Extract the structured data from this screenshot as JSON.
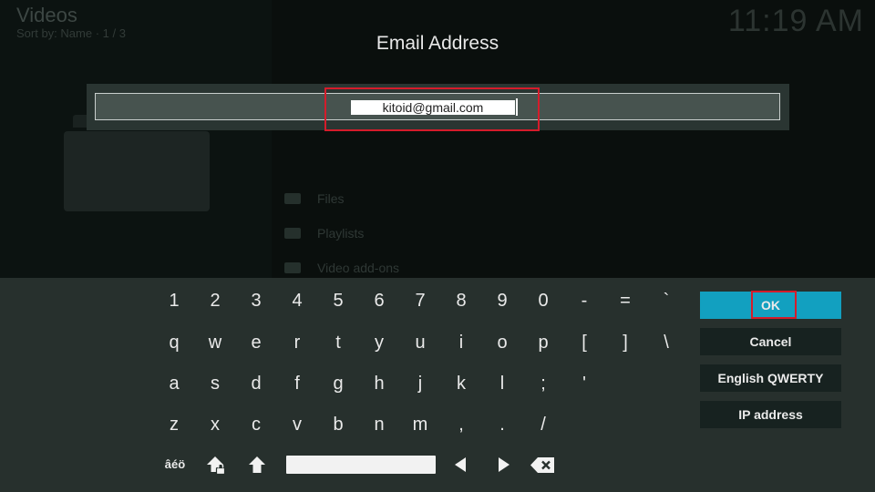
{
  "background": {
    "title": "Videos",
    "sort": "Sort by: Name  ·  1 / 3",
    "clock": "11:19 AM",
    "items": [
      {
        "label": "Files",
        "icon": "folder-icon"
      },
      {
        "label": "Playlists",
        "icon": "playlist-icon"
      },
      {
        "label": "Video add-ons",
        "icon": "addons-icon"
      }
    ]
  },
  "dialog": {
    "title": "Email Address",
    "input_value": "kitoid@gmail.com",
    "input_masked": true
  },
  "keyboard": {
    "rows": [
      [
        "1",
        "2",
        "3",
        "4",
        "5",
        "6",
        "7",
        "8",
        "9",
        "0",
        "-",
        "=",
        "`"
      ],
      [
        "q",
        "w",
        "e",
        "r",
        "t",
        "y",
        "u",
        "i",
        "o",
        "p",
        "[",
        "]",
        "\\"
      ],
      [
        "a",
        "s",
        "d",
        "f",
        "g",
        "h",
        "j",
        "k",
        "l",
        ";",
        "'"
      ],
      [
        "z",
        "x",
        "c",
        "v",
        "b",
        "n",
        "m",
        ",",
        ".",
        "/"
      ]
    ],
    "special_row": {
      "accents_label": "âéö",
      "icons": [
        "caps-lock-icon",
        "shift-icon",
        "space-icon",
        "left-arrow-icon",
        "right-arrow-icon",
        "backspace-icon"
      ]
    }
  },
  "buttons": {
    "ok": "OK",
    "cancel": "Cancel",
    "layout": "English QWERTY",
    "ip": "IP address"
  },
  "colors": {
    "accent": "#12a0c0",
    "highlight": "#d51c2b"
  }
}
